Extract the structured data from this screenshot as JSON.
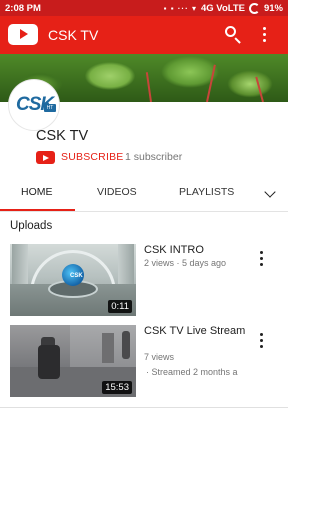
{
  "status_bar": {
    "time": "2:08 PM",
    "network": "4G VoLTE",
    "battery": "91%"
  },
  "app_bar": {
    "title": "CSK TV"
  },
  "channel": {
    "name": "CSK TV",
    "avatar_text": "CSK",
    "avatar_badge": "HT",
    "subscribe_label": "SUBSCRIBE",
    "subscriber_count": "1 subscriber"
  },
  "tabs": [
    {
      "label": "HOME",
      "active": true
    },
    {
      "label": "VIDEOS",
      "active": false
    },
    {
      "label": "PLAYLISTS",
      "active": false
    }
  ],
  "uploads": {
    "heading": "Uploads",
    "videos": [
      {
        "title": "CSK INTRO",
        "meta": "2 views · 5 days ago",
        "duration": "0:11",
        "thumb_logo": "CSK"
      },
      {
        "title": "CSK TV Live Stream",
        "views": "7 views",
        "streamed": "· Streamed 2 months a",
        "duration": "15:53"
      }
    ]
  },
  "colors": {
    "brand_red": "#e62117",
    "status_red": "#c81c1c"
  },
  "icons": [
    "youtube-logo-icon",
    "search-icon",
    "more-vert-icon",
    "chevron-down-icon"
  ]
}
